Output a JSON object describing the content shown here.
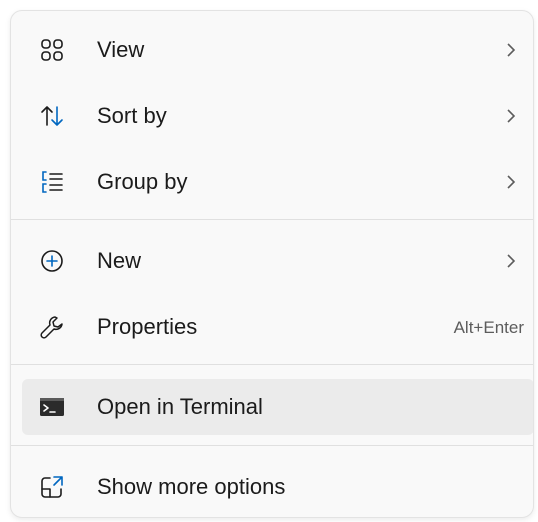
{
  "menu": {
    "items": [
      {
        "label": "View",
        "icon": "view-grid-icon",
        "submenu": true
      },
      {
        "label": "Sort by",
        "icon": "sort-arrows-icon",
        "submenu": true
      },
      {
        "label": "Group by",
        "icon": "group-list-icon",
        "submenu": true
      },
      {
        "label": "New",
        "icon": "plus-circle-icon",
        "submenu": true
      },
      {
        "label": "Properties",
        "icon": "wrench-icon",
        "shortcut": "Alt+Enter"
      },
      {
        "label": "Open in Terminal",
        "icon": "terminal-icon",
        "highlighted": true
      },
      {
        "label": "Show more options",
        "icon": "show-more-options-icon"
      }
    ]
  },
  "colors": {
    "accent": "#0067c0",
    "background": "#f9f9f9",
    "highlight": "#ebebeb",
    "text": "#1b1b1b"
  }
}
